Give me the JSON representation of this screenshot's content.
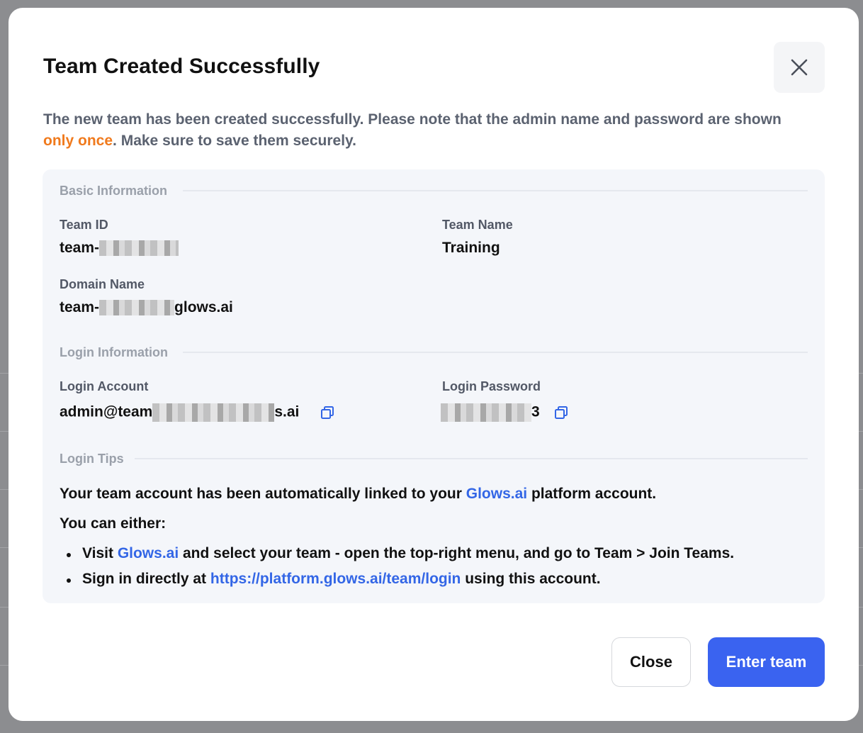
{
  "dialog": {
    "title": "Team Created Successfully",
    "intro_before": "The new team has been created successfully. Please note that the admin name and password are shown ",
    "intro_accent": "only once",
    "intro_after": ". Make sure to save them securely.",
    "close_icon": "close-icon"
  },
  "basic_info": {
    "section_label": "Basic Information",
    "team_id_label": "Team ID",
    "team_id_value_prefix": "team-",
    "team_name_label": "Team Name",
    "team_name_value": "Training",
    "domain_label": "Domain Name",
    "domain_value_prefix": "team-",
    "domain_value_suffix": "glows.ai"
  },
  "login_info": {
    "section_label": "Login Information",
    "account_label": "Login Account",
    "account_value_prefix": "admin@team",
    "account_value_suffix": "s.ai",
    "password_label": "Login Password",
    "password_value_suffix": "3",
    "copy_icon": "copy-icon"
  },
  "login_tips": {
    "section_label": "Login Tips",
    "line1_before": "Your team account has been automatically linked to your ",
    "line1_link": "Glows.ai",
    "line1_after": " platform account.",
    "line2": "You can either:",
    "bullet1_before": "Visit ",
    "bullet1_link": "Glows.ai",
    "bullet1_after": " and select your team - open the top-right menu, and go to Team > Join Teams.",
    "bullet2_before": "Sign in directly at ",
    "bullet2_link": "https://platform.glows.ai/team/login",
    "bullet2_after": " using this account."
  },
  "footer": {
    "close_label": "Close",
    "enter_label": "Enter team"
  },
  "colors": {
    "accent_orange": "#f07a1d",
    "link_blue": "#3366e6",
    "primary_button": "#3a63f0"
  }
}
